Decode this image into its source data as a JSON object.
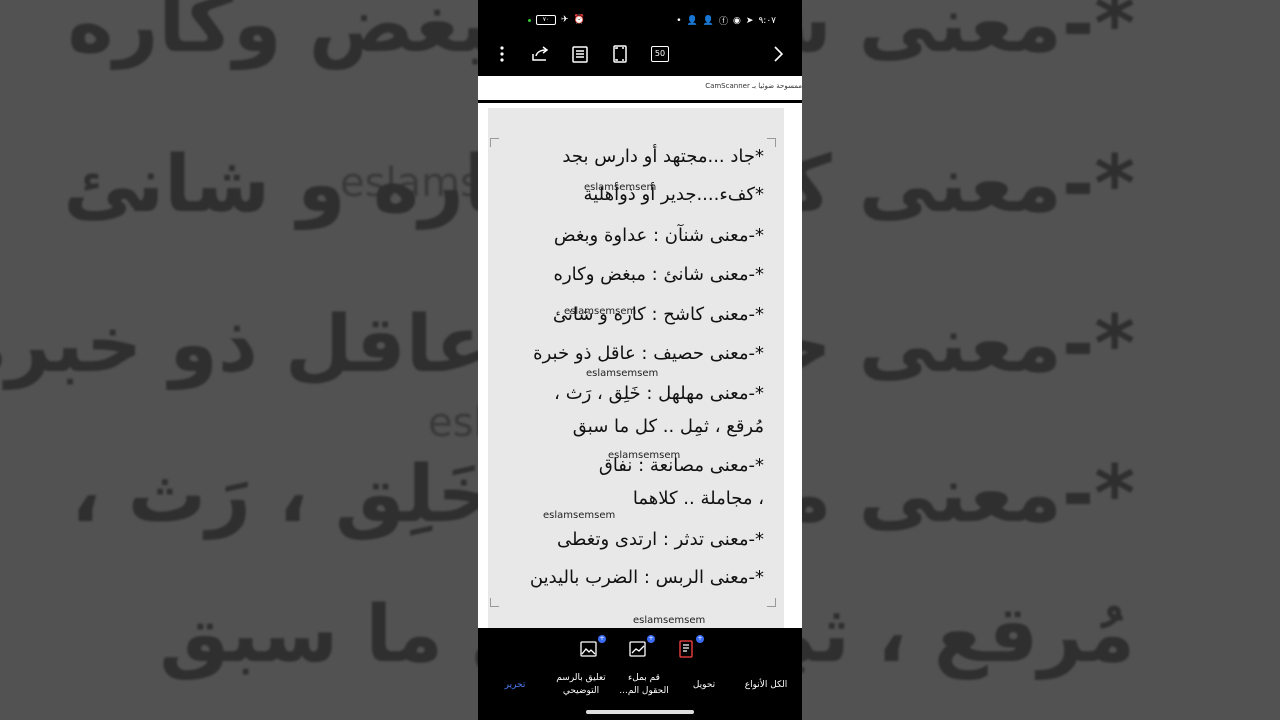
{
  "statusbar": {
    "time": "٩:٠٧",
    "battery": "٧٠"
  },
  "toolbar": {
    "page_count": "50"
  },
  "document": {
    "header_strip": "ممسوحة ضوئيا بـ CamScanner",
    "watermark": "eslamsemsem",
    "lines": [
      "*جاد ...مجتهد أو دارس بجد",
      "*كفء....جدير أو ذوأهلية",
      "*-معنى شنآن : عداوة وبغض",
      "*-معنى شانئ : مبغض وكاره",
      "*-معنى كاشح : كاره و شانئ",
      "*-معنى حصيف : عاقل ذو خبرة",
      "*-معنى مهلهل : خَلِق ، رَث ،",
      "مُرقع ، ثمِل .. كل ما سبق",
      "*-معنى مصانعة : نفاق",
      "، مجاملة .. كلاهما",
      "*-معنى تدثر : ارتدى وتغطى",
      "*-معنى الربس : الضرب باليدين"
    ]
  },
  "backdrop": {
    "lines": [
      "*-معنى شانئ : مبغض وكاره",
      "*-معنى كاشح : كاره و شانئ",
      "*-معنى حصيف : عاقل ذو خبرة",
      "*-معنى مهلهل : خَلِق ، رَث ،",
      "مُرقع ، ثمِل .. كل ما سبق"
    ]
  },
  "bottom": {
    "tabs": [
      {
        "label": "تحرير"
      },
      {
        "label": "تعليق بالرسم التوضيحي"
      },
      {
        "label": "قم بملء الحقول الم..."
      },
      {
        "label": "تحويل"
      },
      {
        "label": "الكل الأنواع"
      }
    ],
    "badge": "+"
  },
  "colors": {
    "accent": "#4a7df7",
    "badge": "#3b6cf5",
    "scan_bg": "#e8e8e8"
  }
}
